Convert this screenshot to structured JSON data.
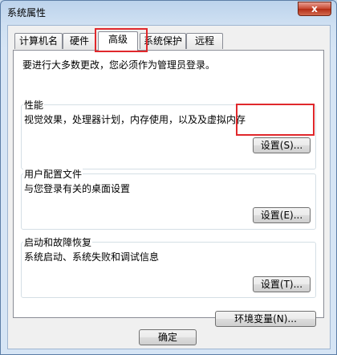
{
  "window": {
    "title": "系统属性",
    "close_label": "x"
  },
  "tabs": [
    {
      "label": "计算机名"
    },
    {
      "label": "硬件"
    },
    {
      "label": "高级",
      "active": true
    },
    {
      "label": "系统保护"
    },
    {
      "label": "远程"
    }
  ],
  "advanced": {
    "notice": "要进行大多数更改，您必须作为管理员登录。",
    "performance": {
      "title": "性能",
      "description": "视觉效果，处理器计划，内存使用，以及及虚拟内存",
      "button": "设置(S)..."
    },
    "user_profiles": {
      "title": "用户配置文件",
      "description": "与您登录有关的桌面设置",
      "button": "设置(E)..."
    },
    "startup_recovery": {
      "title": "启动和故障恢复",
      "description": "系统启动、系统失败和调试信息",
      "button": "设置(T)..."
    },
    "env_button": "环境变量(N)..."
  },
  "footer": {
    "ok": "确定"
  },
  "colors": {
    "highlight": "#e0282c"
  }
}
